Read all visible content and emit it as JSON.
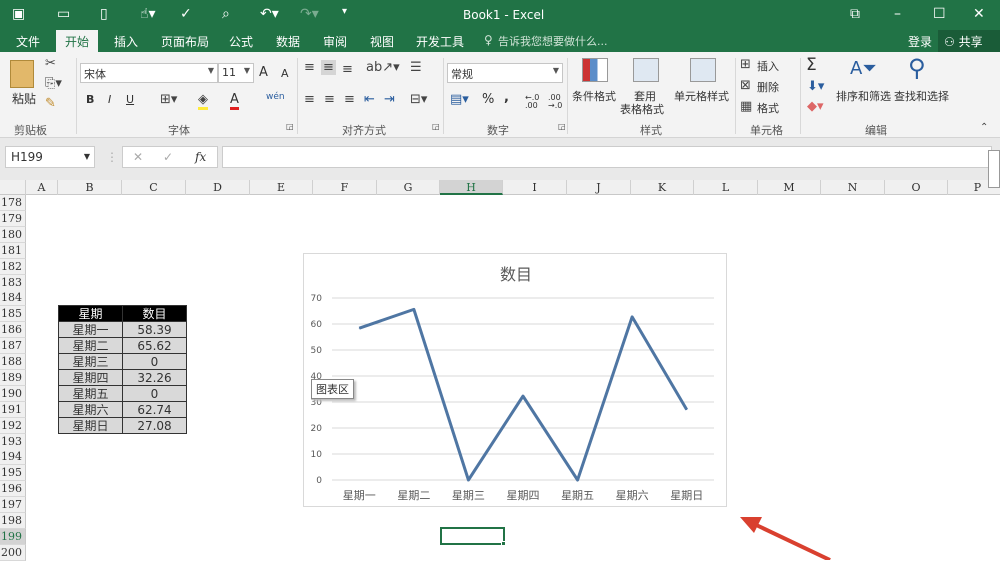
{
  "window": {
    "title": "Book1 - Excel"
  },
  "ribbon_tabs": [
    "文件",
    "开始",
    "插入",
    "页面布局",
    "公式",
    "数据",
    "审阅",
    "视图",
    "开发工具"
  ],
  "tell_me": "告诉我您想要做什么...",
  "account": {
    "login": "登录",
    "share": "共享"
  },
  "clipboard": {
    "paste": "粘贴",
    "group": "剪贴板"
  },
  "font": {
    "name": "宋体",
    "size": "11",
    "group": "字体",
    "bold": "B",
    "italic": "I",
    "underline": "U",
    "grow": "A",
    "shrink": "A",
    "font_color": "A",
    "phonetic": "wén"
  },
  "alignment": {
    "group": "对齐方式"
  },
  "number": {
    "format": "常规",
    "group": "数字",
    "percent": "%",
    "comma": ",",
    "inc": "←.0 .00",
    "dec": ".00 →.0"
  },
  "styles": {
    "conditional": "条件格式",
    "table_line1": "套用",
    "table_line2": "表格格式",
    "cell_styles": "单元格样式",
    "group": "样式"
  },
  "cells": {
    "insert": "插入",
    "delete": "删除",
    "format": "格式",
    "group": "单元格"
  },
  "editing": {
    "sum": "Σ",
    "sort": "排序和筛选",
    "find": "查找和选择",
    "group": "编辑"
  },
  "formula_bar": {
    "name_box": "H199",
    "fx": "fx",
    "cancel": "✕",
    "enter": "✓",
    "value": ""
  },
  "columns": [
    "A",
    "B",
    "C",
    "D",
    "E",
    "F",
    "G",
    "H",
    "I",
    "J",
    "K",
    "L",
    "M",
    "N",
    "O",
    "P"
  ],
  "selected_column": "H",
  "rows": [
    "178",
    "179",
    "180",
    "181",
    "182",
    "183",
    "184",
    "185",
    "186",
    "187",
    "188",
    "189",
    "190",
    "191",
    "192",
    "193",
    "194",
    "195",
    "196",
    "197",
    "198",
    "199",
    "200"
  ],
  "selected_row": "199",
  "table": {
    "headers": [
      "星期",
      "数目"
    ],
    "rows": [
      [
        "星期一",
        "58.39"
      ],
      [
        "星期二",
        "65.62"
      ],
      [
        "星期三",
        "0"
      ],
      [
        "星期四",
        "32.26"
      ],
      [
        "星期五",
        "0"
      ],
      [
        "星期六",
        "62.74"
      ],
      [
        "星期日",
        "27.08"
      ]
    ]
  },
  "tooltip": "图表区",
  "chart_data": {
    "type": "line",
    "title": "数目",
    "categories": [
      "星期一",
      "星期二",
      "星期三",
      "星期四",
      "星期五",
      "星期六",
      "星期日"
    ],
    "series": [
      {
        "name": "数目",
        "values": [
          58.39,
          65.62,
          0,
          32.26,
          0,
          62.74,
          27.08
        ],
        "color": "#4f76a3"
      }
    ],
    "ylim": [
      0,
      70
    ],
    "yticks": [
      "0",
      "10",
      "20",
      "30",
      "40",
      "50",
      "60",
      "70"
    ],
    "grid": true,
    "legend": "none"
  },
  "colors": {
    "brand": "#217346",
    "arrow": "#d9402f"
  }
}
